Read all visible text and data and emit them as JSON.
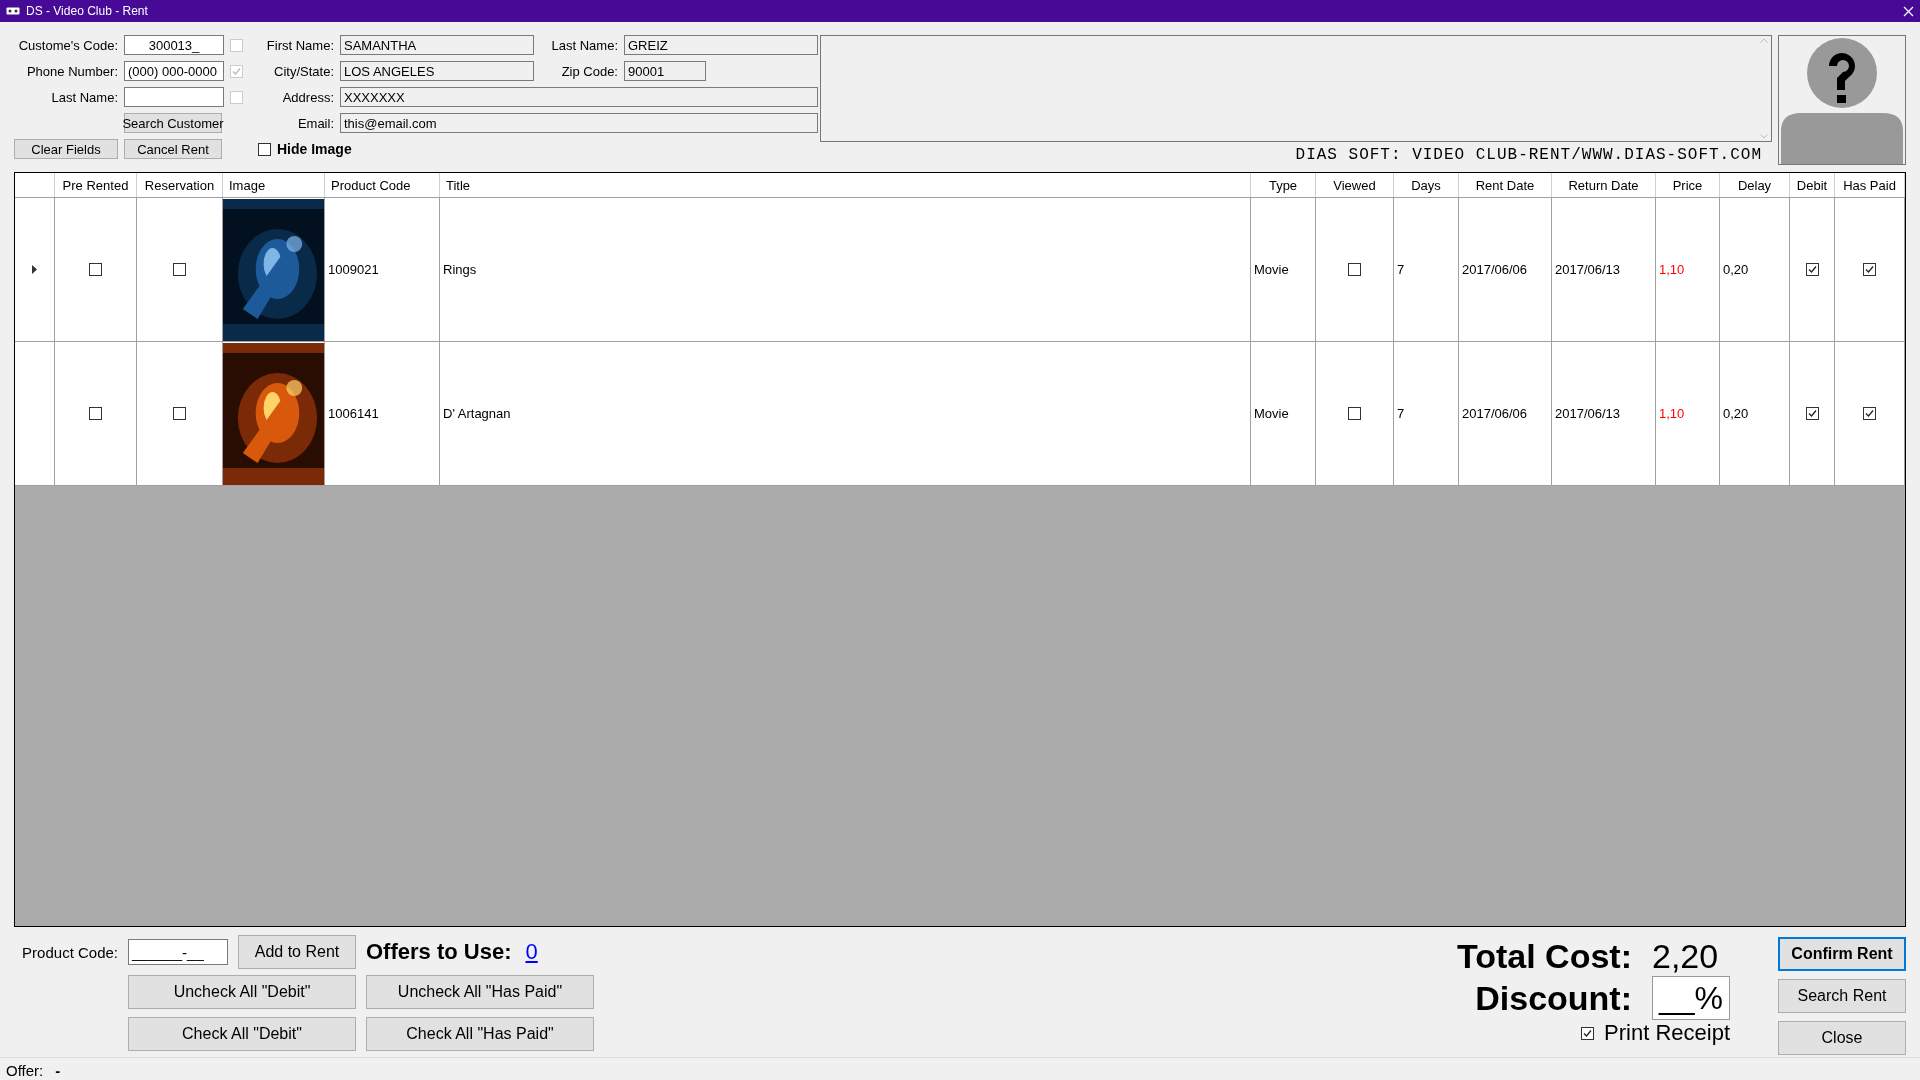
{
  "window": {
    "title": "DS - Video Club - Rent"
  },
  "customer": {
    "code": {
      "label": "Custome's Code:",
      "value": "300013_",
      "checked": false
    },
    "phone": {
      "label": "Phone Number:",
      "value": "(000) 000-0000",
      "checked": true
    },
    "last_name_search": {
      "label": "Last Name:",
      "checked": false
    },
    "search_button": "Search Customer",
    "first_name": {
      "label": "First Name:",
      "value": "SAMANTHA"
    },
    "last_name": {
      "label": "Last Name:",
      "value": "GREIZ"
    },
    "city_state": {
      "label": "City/State:",
      "value": "LOS ANGELES"
    },
    "zip_code": {
      "label": "Zip Code:",
      "value": "90001"
    },
    "address": {
      "label": "Address:",
      "value": "XXXXXXX"
    },
    "email": {
      "label": "Email:",
      "value": "this@email.com"
    }
  },
  "buttons": {
    "clear_fields": "Clear Fields",
    "cancel_rent": "Cancel Rent"
  },
  "hide_image": {
    "label": "Hide Image",
    "checked": false
  },
  "brand": "DIAS SOFT: VIDEO CLUB-RENT/WWW.DIAS-SOFT.COM",
  "table": {
    "columns": [
      "Pre Rented",
      "Reservation",
      "Image",
      "Product Code",
      "Title",
      "Type",
      "Viewed",
      "Days",
      "Rent Date",
      "Return Date",
      "Price",
      "Delay",
      "Debit",
      "Has Paid"
    ],
    "rows": [
      {
        "selected": true,
        "pre_rented": false,
        "reservation": false,
        "product_code": "1009021",
        "title": "Rings",
        "type": "Movie",
        "viewed": false,
        "days": "7",
        "rent_date": "2017/06/06",
        "return_date": "2017/06/13",
        "price": "1,10",
        "delay": "0,20",
        "debit": true,
        "has_paid": true
      },
      {
        "selected": false,
        "pre_rented": false,
        "reservation": false,
        "product_code": "1006141",
        "title": "D' Artagnan",
        "type": "Movie",
        "viewed": false,
        "days": "7",
        "rent_date": "2017/06/06",
        "return_date": "2017/06/13",
        "price": "1,10",
        "delay": "0,20",
        "debit": true,
        "has_paid": true
      }
    ]
  },
  "bottom": {
    "product_code": {
      "label": "Product Code:",
      "value": "______-__"
    },
    "add_to_rent": "Add to Rent",
    "offers": {
      "label": "Offers to Use:",
      "value": "0"
    },
    "check_buttons": [
      "Uncheck All \"Debit\"",
      "Uncheck All \"Has Paid\"",
      "Check All \"Debit\"",
      "Check All \"Has Paid\""
    ],
    "total_cost": {
      "label": "Total Cost:",
      "value": "2,20"
    },
    "discount": {
      "label": "Discount:",
      "value": "__%"
    },
    "print_receipt": {
      "label": "Print Receipt",
      "checked": true
    },
    "actions": [
      {
        "label": "Confirm Rent",
        "focused": true
      },
      {
        "label": "Search Rent",
        "focused": false
      },
      {
        "label": "Close",
        "focused": false
      }
    ]
  },
  "status_bar": {
    "label": "Offer:",
    "value": "-"
  }
}
